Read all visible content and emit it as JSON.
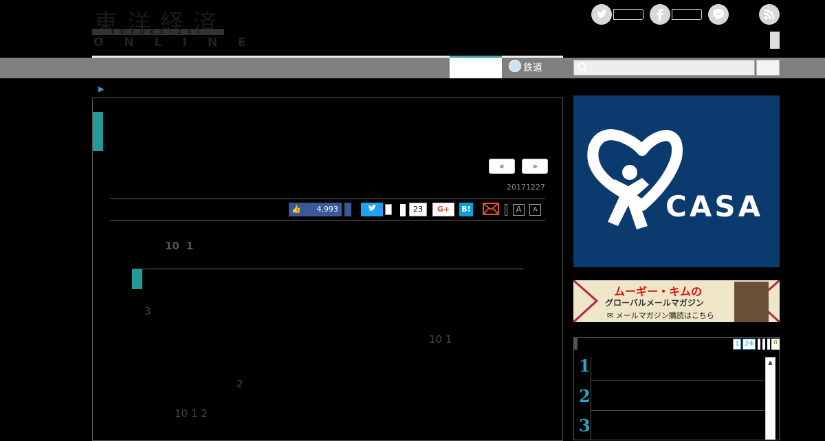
{
  "header": {
    "logo_kanji": "東洋経済",
    "logo_romaji": "TOYOKEIZAI",
    "logo_online": "ONLINE"
  },
  "nav": {
    "rail_tab_label": "鉄道"
  },
  "article": {
    "prev_label": "«",
    "next_label": "»",
    "date": "20171227",
    "like_count": "4,993",
    "pocket_count": "23",
    "gplus_label": "G+",
    "hatena_label": "B!",
    "font_large_label": "A",
    "font_small_label": "A",
    "lead": "10 1",
    "lead_num_a": "10",
    "lead_num_b": "1",
    "heading": "",
    "para1_prefix": "3",
    "para2_nums": "10 1",
    "para3_num": "2",
    "para4_nums": "10 1 2"
  },
  "sidebar": {
    "ad_casa_label": "CASA",
    "ad_kim_title": "ムーギー・キムの",
    "ad_kim_sub": "グローバルメールマガジン",
    "ad_kim_link": "メールマガジン購読はこちら",
    "rank_tabs": [
      "1",
      "24"
    ],
    "rank_numbers": [
      "1",
      "2",
      "3"
    ]
  },
  "colors": {
    "accent_teal": "#239a9a",
    "link_blue": "#2aa4c8",
    "casa_blue": "#0b3a6e"
  }
}
